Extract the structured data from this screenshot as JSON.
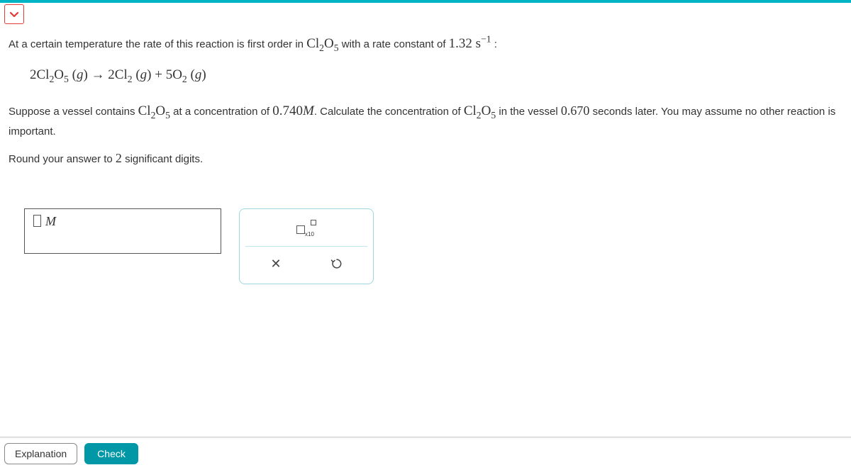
{
  "problem": {
    "p1_a": "At a certain temperature the rate of this reaction is first order in ",
    "p1_species": "Cl<sub>2</sub>O<sub>5</sub>",
    "p1_b": " with a rate constant of ",
    "p1_rate": "1.32 s<sup>&minus;1</sup>",
    "p1_c": " :",
    "equation": "2Cl<sub>2</sub>O<sub>5</sub> (<i>g</i>) &rarr; 2Cl<sub>2</sub> (<i>g</i>) + 5O<sub>2</sub> (<i>g</i>)",
    "p2_a": "Suppose a vessel contains ",
    "p2_b": " at a concentration of ",
    "p2_conc": "0.740<i>M</i>",
    "p2_c": ". Calculate the concentration of ",
    "p2_d": " in the vessel ",
    "p2_time": "0.670",
    "p2_e": " seconds later. You may assume no other reaction is important.",
    "p3_a": "Round your answer to ",
    "p3_sig": "2",
    "p3_b": " significant digits."
  },
  "answer": {
    "unit": "M"
  },
  "footer": {
    "explanation": "Explanation",
    "check": "Check"
  }
}
